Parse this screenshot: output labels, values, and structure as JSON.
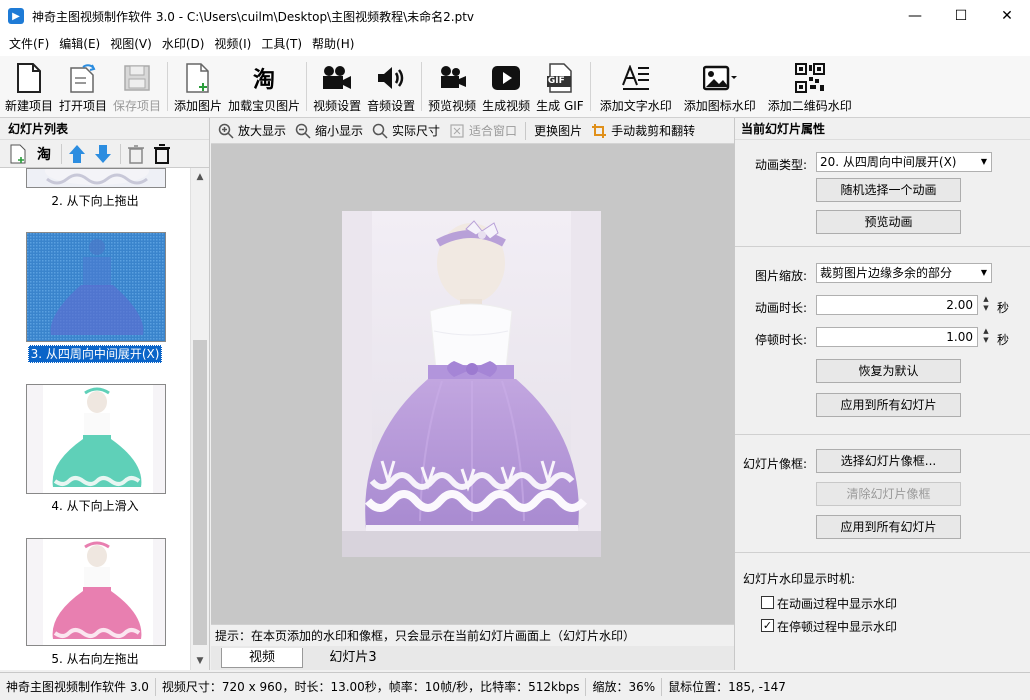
{
  "window": {
    "title": "神奇主图视频制作软件 3.0 - C:\\Users\\cuilm\\Desktop\\主图视频教程\\未命名2.ptv",
    "app_icon": "video-app-icon",
    "minimize": "—",
    "maximize": "☐",
    "close": "✕"
  },
  "menu": [
    "文件(F)",
    "编辑(E)",
    "视图(V)",
    "水印(D)",
    "视频(I)",
    "工具(T)",
    "帮助(H)"
  ],
  "toolbar": {
    "new_project": "新建项目",
    "open_project": "打开项目",
    "save_project": "保存项目",
    "add_image": "添加图片",
    "load_taobao": "加载宝贝图片",
    "taobao_glyph": "淘",
    "video_settings": "视频设置",
    "audio_settings": "音频设置",
    "preview_video": "预览视频",
    "generate_video": "生成视频",
    "generate_gif": "生成 GIF",
    "gif_glyph": "GIF",
    "add_text_watermark": "添加文字水印",
    "add_icon_watermark": "添加图标水印",
    "add_qr_watermark": "添加二维码水印"
  },
  "left": {
    "header": "幻灯片列表",
    "taobao_glyph": "淘",
    "slides": [
      {
        "label": "2. 从下向上拖出"
      },
      {
        "label": "3. 从四周向中间展开(X)"
      },
      {
        "label": "4. 从下向上滑入"
      },
      {
        "label": "5. 从右向左拖出"
      }
    ]
  },
  "center": {
    "zoom_in": "放大显示",
    "zoom_out": "缩小显示",
    "actual_size": "实际尺寸",
    "fit_window": "适合窗口",
    "replace_image": "更换图片",
    "crop_flip": "手动裁剪和翻转",
    "hint": "提示：在本页添加的水印和像框，只会显示在当前幻灯片画面上（幻灯片水印）",
    "tabs": [
      "视频",
      "幻灯片3"
    ]
  },
  "right": {
    "header": "当前幻灯片属性",
    "anim_type_label": "动画类型:",
    "anim_type_value": "20. 从四周向中间展开(X)",
    "random_anim": "随机选择一个动画",
    "preview_anim": "预览动画",
    "scale_label": "图片缩放:",
    "scale_value": "裁剪图片边缘多余的部分",
    "anim_duration_label": "动画时长:",
    "anim_duration_value": "2.00",
    "pause_label": "停顿时长:",
    "pause_value": "1.00",
    "seconds": "秒",
    "reset_default": "恢复为默认",
    "apply_all_1": "应用到所有幻灯片",
    "frame_label": "幻灯片像框:",
    "choose_frame": "选择幻灯片像框...",
    "clear_frame": "清除幻灯片像框",
    "apply_all_2": "应用到所有幻灯片",
    "watermark_timing_label": "幻灯片水印显示时机:",
    "during_anim": "在动画过程中显示水印",
    "during_anim_checked": false,
    "during_pause": "在停顿过程中显示水印",
    "during_pause_checked": true,
    "check_mark": "✓"
  },
  "status": {
    "app": "神奇主图视频制作软件 3.0",
    "info": "视频尺寸：720 x 960，时长：13.00秒，帧率：10帧/秒，比特率：512kbps",
    "zoom": "缩放：36%",
    "mouse": "鼠标位置：185, -147"
  },
  "colors": {
    "selection": "#0a64c8",
    "dress_purple": "#b89ad8",
    "dress_teal": "#5fd0b8",
    "dress_pink": "#e87fb0",
    "accent_blue": "#2c8de0"
  }
}
